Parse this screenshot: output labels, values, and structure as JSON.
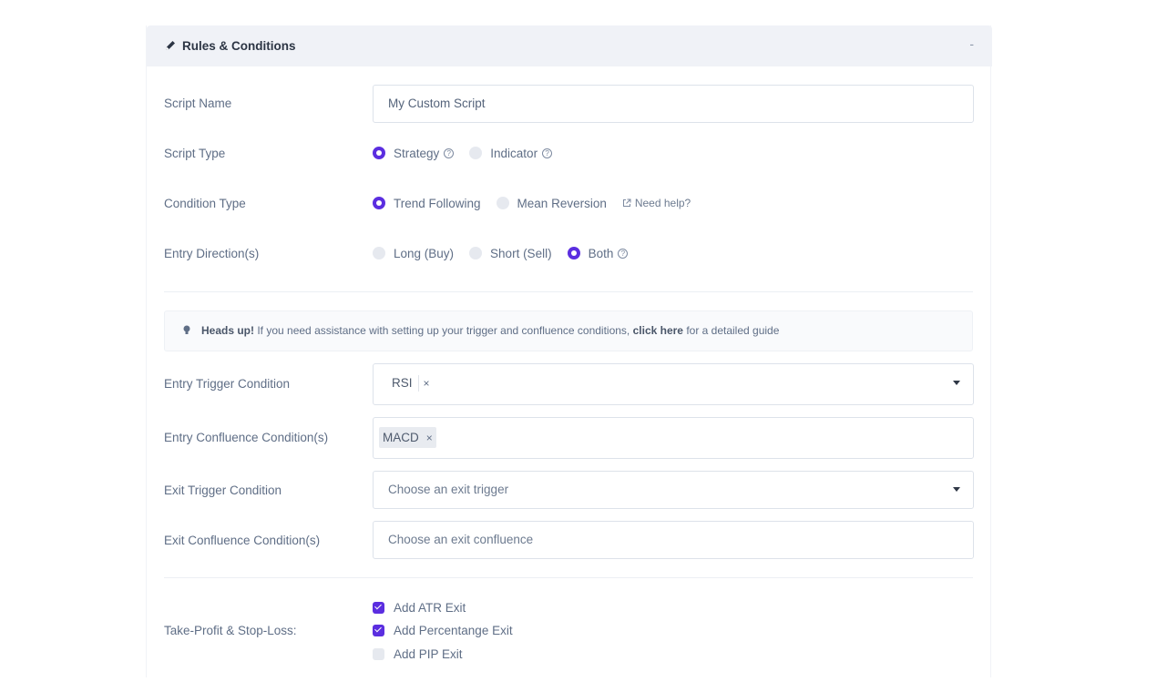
{
  "header": {
    "title": "Rules & Conditions",
    "collapse": "-",
    "icon": "pencil-icon"
  },
  "script_name": {
    "label": "Script Name",
    "value": "My Custom Script"
  },
  "script_type": {
    "label": "Script Type",
    "options": [
      {
        "label": "Strategy",
        "selected": true
      },
      {
        "label": "Indicator",
        "selected": false
      }
    ]
  },
  "condition_type": {
    "label": "Condition Type",
    "options": [
      {
        "label": "Trend Following",
        "selected": true
      },
      {
        "label": "Mean Reversion",
        "selected": false
      }
    ],
    "help_link": "Need help?"
  },
  "entry_direction": {
    "label": "Entry Direction(s)",
    "options": [
      {
        "label": "Long (Buy)",
        "selected": false
      },
      {
        "label": "Short (Sell)",
        "selected": false
      },
      {
        "label": "Both",
        "selected": true
      }
    ]
  },
  "alert": {
    "strong": "Heads up!",
    "text": " If you need assistance with setting up your trigger and confluence conditions, ",
    "link": "click here",
    "suffix": " for a detailed guide"
  },
  "entry_trigger": {
    "label": "Entry Trigger Condition",
    "tag": "RSI",
    "remove": "×"
  },
  "entry_confluence": {
    "label": "Entry Confluence Condition(s)",
    "tag": "MACD",
    "remove": "×"
  },
  "exit_trigger": {
    "label": "Exit Trigger Condition",
    "placeholder": "Choose an exit trigger"
  },
  "exit_confluence": {
    "label": "Exit Confluence Condition(s)",
    "placeholder": "Choose an exit confluence"
  },
  "tp_sl": {
    "label": "Take-Profit & Stop-Loss:",
    "options": [
      {
        "label": "Add ATR Exit",
        "checked": true
      },
      {
        "label": "Add Percentange Exit",
        "checked": true
      },
      {
        "label": "Add PIP Exit",
        "checked": false
      }
    ]
  },
  "colors": {
    "accent": "#5b2ee0",
    "header_bg": "#f0f2f7"
  }
}
